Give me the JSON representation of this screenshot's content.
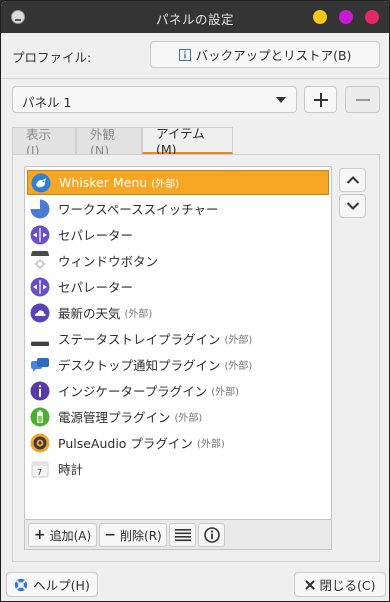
{
  "window": {
    "title": "パネルの設定",
    "app_icon": "xfce-panel-icon",
    "controls": {
      "minimize": "#f6c915",
      "maximize": "#c61bd6",
      "close": "#e2296a"
    }
  },
  "profile": {
    "label": "プロファイル:",
    "backup_button": "バックアップとリストア(B)",
    "backup_icon": "info-box-icon"
  },
  "panel_selector": {
    "value": "パネル 1",
    "add_icon": "plus-icon",
    "remove_icon": "minus-icon"
  },
  "tabs": [
    {
      "label": "表示(I)",
      "active": false
    },
    {
      "label": "外観(N)",
      "active": false
    },
    {
      "label": "アイテム(M)",
      "active": true
    }
  ],
  "items": [
    {
      "name": "Whisker Menu",
      "tag": "(外部)",
      "icon": "whisker-menu-icon",
      "selected": true
    },
    {
      "name": "ワークスペーススイッチャー",
      "tag": "",
      "icon": "workspace-switcher-icon",
      "selected": false
    },
    {
      "name": "セパレーター",
      "tag": "",
      "icon": "separator-icon",
      "selected": false
    },
    {
      "name": "ウィンドウボタン",
      "tag": "",
      "icon": "window-buttons-icon",
      "selected": false
    },
    {
      "name": "セパレーター",
      "tag": "",
      "icon": "separator-icon",
      "selected": false
    },
    {
      "name": "最新の天気",
      "tag": "(外部)",
      "icon": "weather-cloud-icon",
      "selected": false
    },
    {
      "name": "ステータストレイプラグイン",
      "tag": "(外部)",
      "icon": "status-tray-icon",
      "selected": false
    },
    {
      "name": "デスクトップ通知プラグイン",
      "tag": "(外部)",
      "icon": "notification-icon",
      "selected": false
    },
    {
      "name": "インジケータープラグイン",
      "tag": "(外部)",
      "icon": "indicator-info-icon",
      "selected": false
    },
    {
      "name": "電源管理プラグイン",
      "tag": "(外部)",
      "icon": "battery-icon",
      "selected": false
    },
    {
      "name": "PulseAudio プラグイン",
      "tag": "(外部)",
      "icon": "speaker-icon",
      "selected": false
    },
    {
      "name": "時計",
      "tag": "",
      "icon": "calendar-clock-icon",
      "selected": false
    }
  ],
  "toolbar": {
    "add_label": "追加(A)",
    "remove_label": "削除(R)",
    "list_icon": "list-icon",
    "about_icon": "about-info-icon"
  },
  "side_buttons": {
    "up_icon": "chevron-up-icon",
    "down_icon": "chevron-down-icon"
  },
  "footer": {
    "help_button": "ヘルプ(H)",
    "help_icon": "lifebuoy-icon",
    "close_button": "閉じる(C)",
    "close_icon": "close-x-icon"
  },
  "colors": {
    "selection": "#f5a623",
    "active_tab_underline": "#e58b25",
    "titlebar": "#343434"
  }
}
